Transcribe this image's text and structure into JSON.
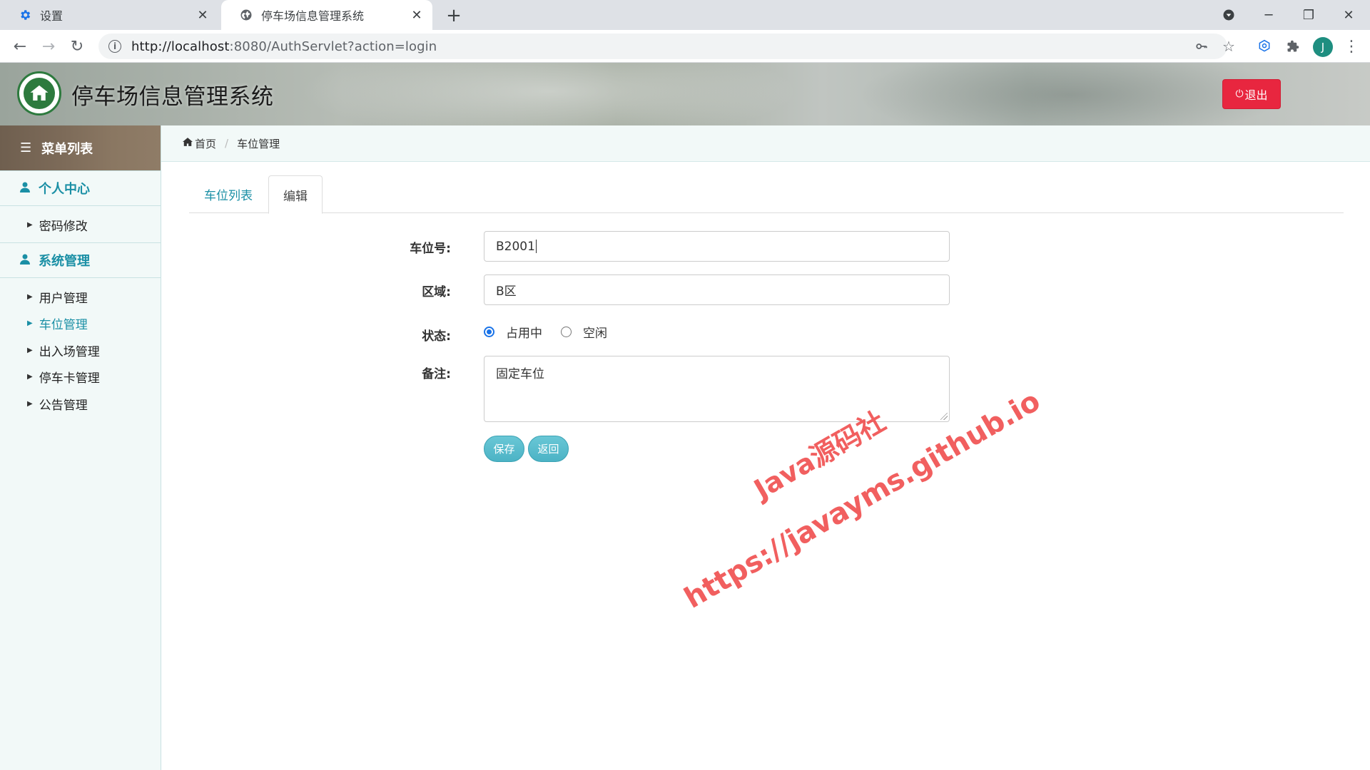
{
  "browser": {
    "tabs": [
      {
        "label": "设置",
        "icon": "gear-icon",
        "active": false
      },
      {
        "label": "停车场信息管理系统",
        "icon": "globe-icon",
        "active": true
      }
    ],
    "url_host": "http://localhost",
    "url_rest": ":8080/AuthServlet?action=login",
    "profile_initial": "J"
  },
  "header": {
    "title": "停车场信息管理系统",
    "logout_label": "退出"
  },
  "sidebar": {
    "menu_title": "菜单列表",
    "groups": [
      {
        "label": "个人中心",
        "items": [
          "密码修改"
        ]
      },
      {
        "label": "系统管理",
        "items": [
          "用户管理",
          "车位管理",
          "出入场管理",
          "停车卡管理",
          "公告管理"
        ]
      }
    ],
    "active_item": "车位管理"
  },
  "breadcrumb": {
    "home": "首页",
    "current": "车位管理"
  },
  "tabs": {
    "list_label": "车位列表",
    "edit_label": "编辑"
  },
  "form": {
    "space_no_label": "车位号:",
    "space_no_value": "B2001",
    "area_label": "区域:",
    "area_value": "B区",
    "status_label": "状态:",
    "status_options": [
      "占用中",
      "空闲"
    ],
    "status_selected": "占用中",
    "remark_label": "备注:",
    "remark_value": "固定车位",
    "save_label": "保存",
    "back_label": "返回"
  },
  "watermark": {
    "line1": "Java源码社",
    "line2": "https://javayms.github.io"
  },
  "colors": {
    "accent": "#1a8fa5",
    "logout": "#e8263f",
    "button": "#5bbccc",
    "watermark": "#ef4444"
  }
}
